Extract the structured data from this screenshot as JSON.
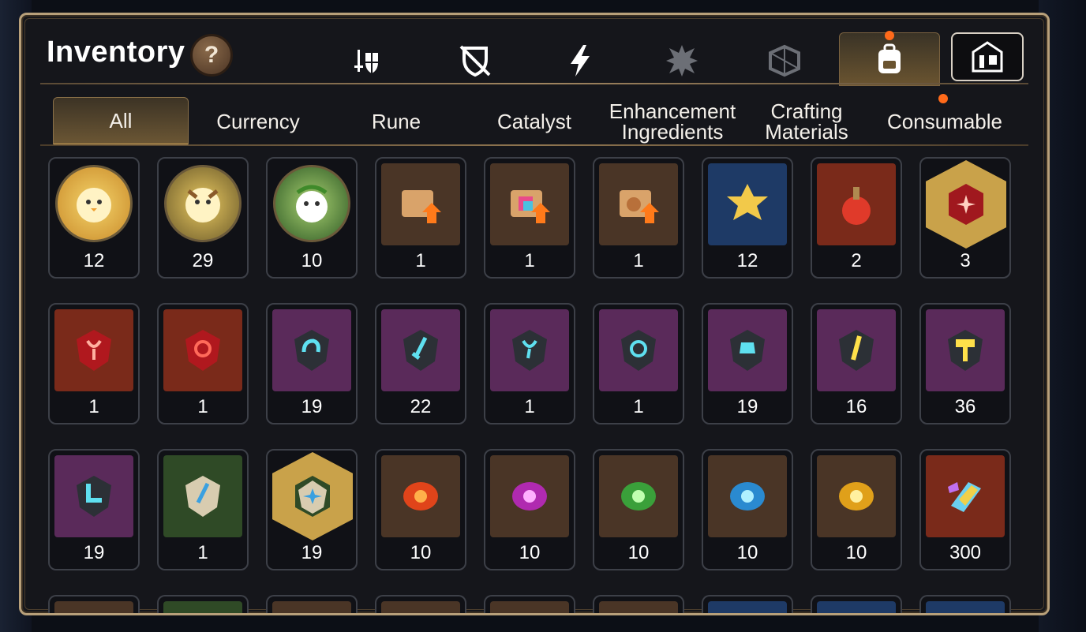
{
  "window": {
    "title": "Inventory",
    "help_label": "?"
  },
  "categories": [
    {
      "icon": "sword-shield-icon"
    },
    {
      "icon": "crossed-shield-icon"
    },
    {
      "icon": "lightning-icon"
    },
    {
      "icon": "spiky-creature-icon"
    },
    {
      "icon": "cracked-cube-icon"
    },
    {
      "icon": "backpack-icon",
      "active": true
    },
    {
      "icon": "armory-icon"
    }
  ],
  "tabs": [
    {
      "label": "All",
      "active": true
    },
    {
      "label": "Currency"
    },
    {
      "label": "Rune"
    },
    {
      "label": "Catalyst"
    },
    {
      "label": "Enhancement Ingredients"
    },
    {
      "label": "Crafting Materials"
    },
    {
      "label": "Consumable"
    }
  ],
  "items": [
    {
      "icon": "golden-mascot-icon",
      "qty": "12"
    },
    {
      "icon": "brown-mascot-icon",
      "qty": "29"
    },
    {
      "icon": "green-mascot-icon",
      "qty": "10"
    },
    {
      "icon": "gold-scroll-icon",
      "qty": "1"
    },
    {
      "icon": "rainbow-scroll-icon",
      "qty": "1"
    },
    {
      "icon": "bag-scroll-icon",
      "qty": "1"
    },
    {
      "icon": "gold-crystal-cluster-icon",
      "qty": "12"
    },
    {
      "icon": "red-potion-icon",
      "qty": "2"
    },
    {
      "icon": "red-rune-hexagon-icon",
      "qty": "3"
    },
    {
      "icon": "red-rune-necklace-icon",
      "qty": "1"
    },
    {
      "icon": "red-rune-ring-icon",
      "qty": "1"
    },
    {
      "icon": "cyan-rune-helmet-icon",
      "qty": "19"
    },
    {
      "icon": "cyan-rune-sword-icon",
      "qty": "22"
    },
    {
      "icon": "cyan-rune-necklace-icon",
      "qty": "1"
    },
    {
      "icon": "cyan-rune-ring-icon",
      "qty": "1"
    },
    {
      "icon": "cyan-rune-armor-icon",
      "qty": "19"
    },
    {
      "icon": "yellow-rune-staff-icon",
      "qty": "16"
    },
    {
      "icon": "yellow-rune-hammer-icon",
      "qty": "36"
    },
    {
      "icon": "cyan-rune-boot-icon",
      "qty": "19"
    },
    {
      "icon": "stone-rune-sword-icon",
      "qty": "1"
    },
    {
      "icon": "stone-rune-star-hexagon-icon",
      "qty": "19"
    },
    {
      "icon": "fire-orb-icon",
      "qty": "10"
    },
    {
      "icon": "purple-orb-icon",
      "qty": "10"
    },
    {
      "icon": "green-orb-icon",
      "qty": "10"
    },
    {
      "icon": "ice-orb-icon",
      "qty": "10"
    },
    {
      "icon": "gold-orb-icon",
      "qty": "10"
    },
    {
      "icon": "rainbow-crystal-icon",
      "qty": "300"
    }
  ],
  "colors": {
    "rarity_red": "#7a2a1a",
    "rarity_purple": "#5a2a5a",
    "rarity_green": "#2f4a26",
    "rarity_blue": "#1e3a66",
    "rarity_brown": "#4a3526",
    "notification_dot": "#ff6a1a"
  }
}
